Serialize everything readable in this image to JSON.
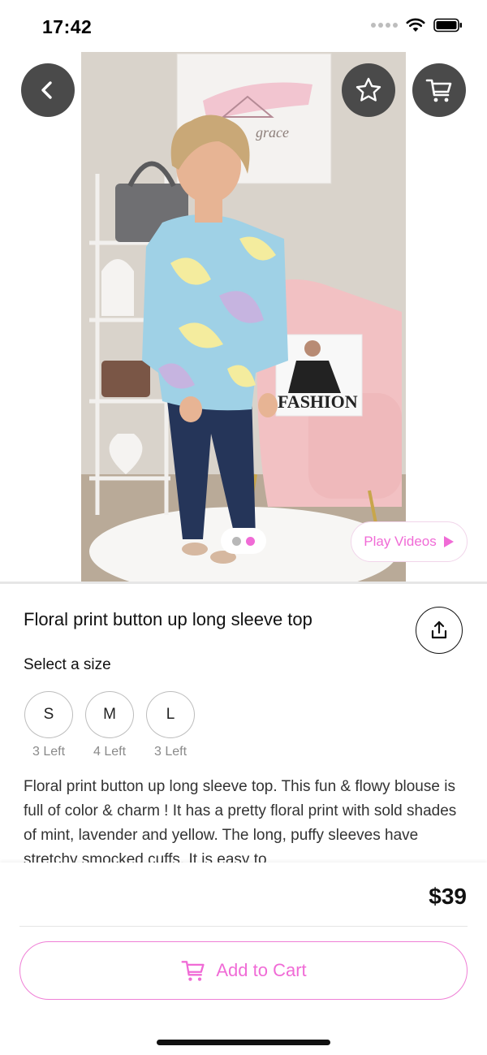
{
  "status_bar": {
    "time": "17:42"
  },
  "hero": {
    "pager": {
      "count": 2,
      "active_index": 1
    },
    "play_videos_label": "Play Videos",
    "photo_text": {
      "sign": "grace",
      "pillow": "FASHION"
    }
  },
  "product": {
    "title": "Floral print button up long sleeve top",
    "size_prompt": "Select a size",
    "sizes": [
      {
        "label": "S",
        "stock": "3 Left"
      },
      {
        "label": "M",
        "stock": "4 Left"
      },
      {
        "label": "L",
        "stock": "3 Left"
      }
    ],
    "description": "Floral print button up long sleeve top. This fun & flowy blouse is full of color & charm !  It has a pretty floral print with sold shades of mint, lavender and yellow.  The long, puffy sleeves have stretchy smocked cuffs.  It is easy to"
  },
  "purchase": {
    "price": "$39",
    "add_to_cart_label": "Add to Cart"
  },
  "icons": {
    "back": "chevron-left-icon",
    "favorite": "star-outline-icon",
    "cart": "cart-icon",
    "share": "share-upload-icon",
    "play": "play-triangle-icon"
  },
  "colors": {
    "accent": "#f06bd6",
    "accent_border": "#ef7fd6",
    "overlay_button": "#4a4a4a",
    "pager_inactive": "#b8b8b8",
    "muted_text": "#8a8a8a"
  }
}
